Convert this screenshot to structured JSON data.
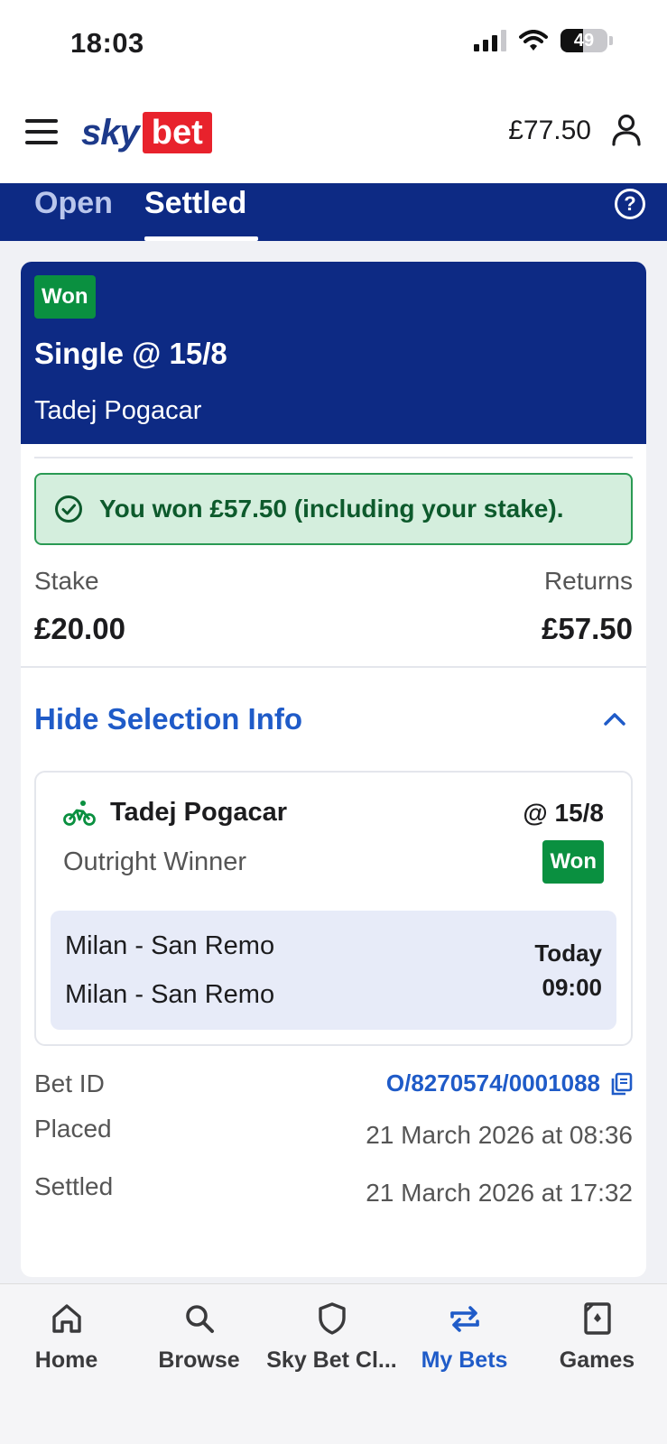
{
  "status": {
    "time": "18:03",
    "battery": "49",
    "battery_level": 0.49
  },
  "header": {
    "logo_sky": "sky",
    "logo_bet": "bet",
    "balance": "£77.50"
  },
  "tabs": [
    {
      "label": "Open"
    },
    {
      "label": "Settled",
      "active": true
    }
  ],
  "bet": {
    "status_badge": "Won",
    "title": "Single @ 15/8",
    "subtitle": "Tadej Pogacar",
    "win_message": "You won £57.50 (including your stake).",
    "stake_label": "Stake",
    "stake_value": "£20.00",
    "returns_label": "Returns",
    "returns_value": "£57.50",
    "selection_toggle": "Hide Selection Info",
    "selection": {
      "name": "Tadej Pogacar",
      "odds": "@ 15/8",
      "market": "Outright Winner",
      "status": "Won",
      "event_name_1": "Milan - San Remo",
      "event_name_2": "Milan - San Remo",
      "event_day": "Today",
      "event_time": "09:00"
    },
    "meta": {
      "bet_id_label": "Bet ID",
      "bet_id": "O/8270574/0001088",
      "placed_label": "Placed",
      "placed_value": "21 March 2026 at 08:36",
      "settled_label": "Settled",
      "settled_value": "21 March 2026 at 17:32"
    }
  },
  "nav": [
    {
      "label": "Home",
      "icon": "home-icon"
    },
    {
      "label": "Browse",
      "icon": "search-icon"
    },
    {
      "label": "Sky Bet Cl...",
      "icon": "shield-icon"
    },
    {
      "label": "My Bets",
      "icon": "swap-arrows-icon",
      "active": true
    },
    {
      "label": "Games",
      "icon": "card-icon"
    }
  ],
  "colors": {
    "brand_blue": "#0d2a84",
    "accent_blue": "#1f5bc8",
    "won_green": "#0a9040",
    "logo_red": "#e8222c"
  }
}
